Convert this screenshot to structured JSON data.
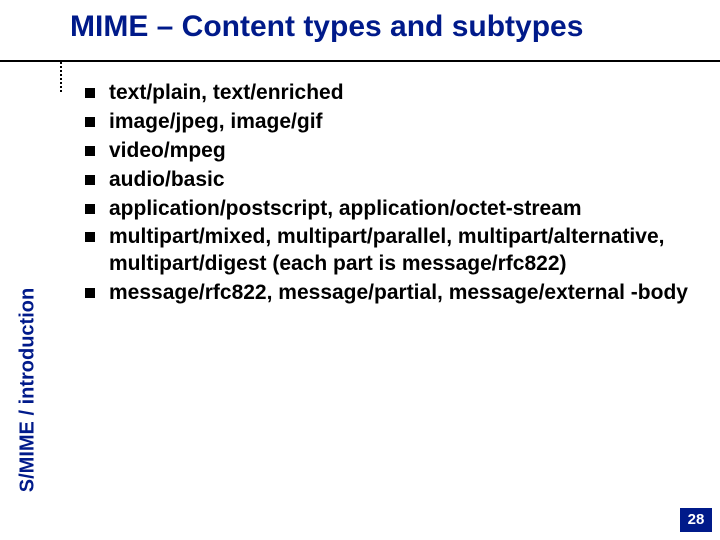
{
  "title": "MIME – Content types and subtypes",
  "sidebar": "S/MIME / introduction",
  "bullets": [
    "text/plain, text/enriched",
    "image/jpeg, image/gif",
    "video/mpeg",
    "audio/basic",
    "application/postscript, application/octet-stream",
    "multipart/mixed, multipart/parallel, multipart/alternative, multipart/digest (each part is message/rfc822)",
    "message/rfc822, message/partial, message/external -body"
  ],
  "page_number": "28"
}
